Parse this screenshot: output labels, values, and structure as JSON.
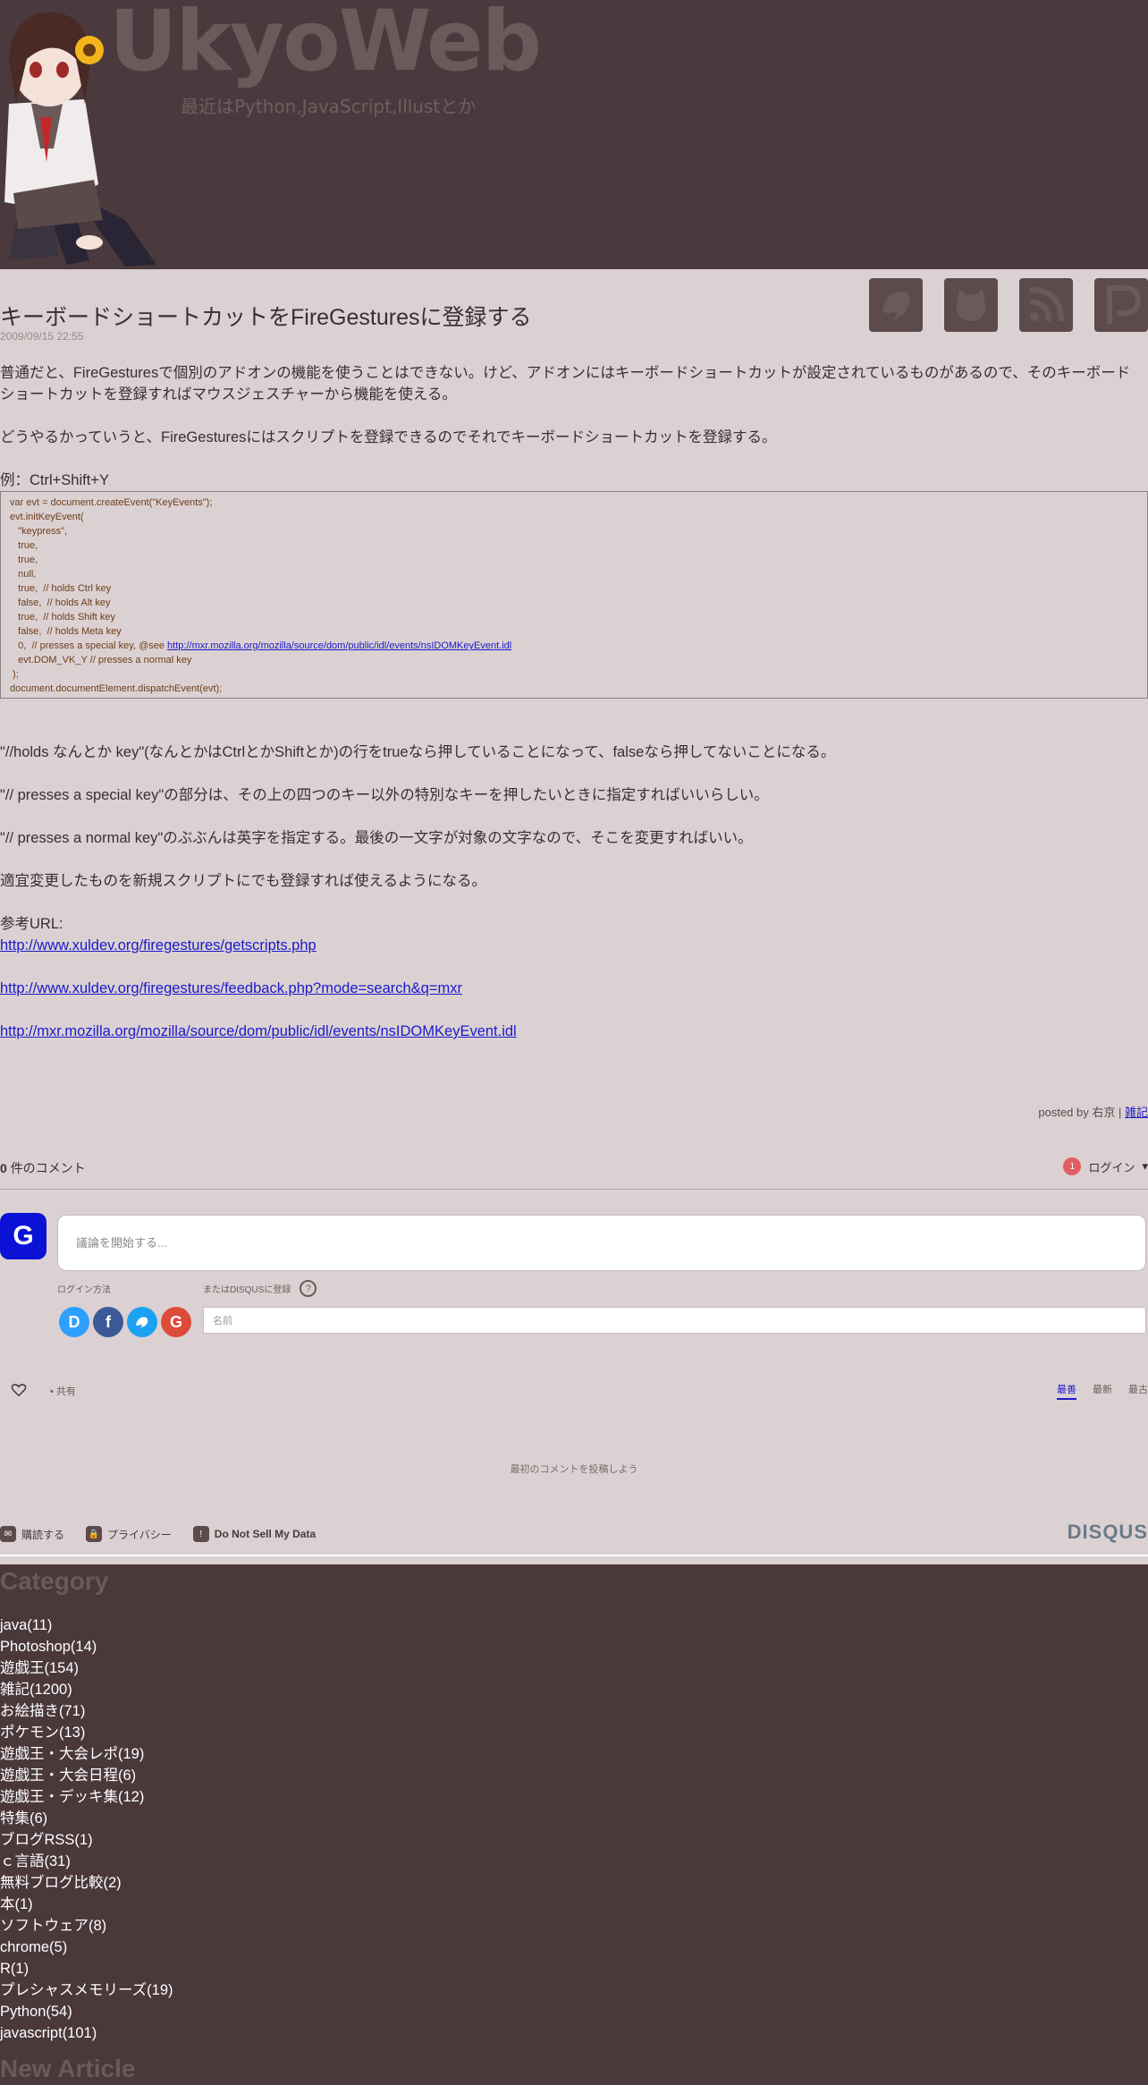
{
  "header": {
    "title": "UkyoWeb",
    "subtitle": "最近はPython,JavaScript,Illustとか"
  },
  "social_icons": [
    "twitter-bird-icon",
    "github-cat-icon",
    "rss-icon",
    "pixiv-icon"
  ],
  "post": {
    "title": "キーボードショートカットをFireGesturesに登録する",
    "date": "2009/09/15 22:55",
    "p1": "普通だと、FireGesturesで個別のアドオンの機能を使うことはできない。けど、アドオンにはキーボードショートカットが設定されているものがあるので、そのキーボードショートカットを登録すればマウスジェスチャーから機能を使える。",
    "p2": "どうやるかっていうと、FireGesturesにはスクリプトを登録できるのでそれでキーボードショートカットを登録する。",
    "example_label": "例：Ctrl+Shift+Y",
    "code": [
      "var evt = document.createEvent(\"KeyEvents\");",
      "evt.initKeyEvent(",
      "   \"keypress\",",
      "   true,",
      "   true,",
      "   null,",
      "   true,  // holds Ctrl key",
      "   false,  // holds Alt key",
      "   true,  // holds Shift key",
      "   false,  // holds Meta key",
      "   0,  // presses a special key, @see ",
      "   evt.DOM_VK_Y // presses a normal key",
      " );",
      "document.documentElement.dispatchEvent(evt);"
    ],
    "code_link": "http://mxr.mozilla.org/mozilla/source/dom/public/idl/events/nsIDOMKeyEvent.idl",
    "p3": "\"//holds なんとか key\"(なんとかはCtrlとかShiftとか)の行をtrueなら押していることになって、falseなら押してないことになる。",
    "p4": "\"// presses a special key\"の部分は、その上の四つのキー以外の特別なキーを押したいときに指定すればいいらしい。",
    "p5": "\"// presses a normal key\"のぶぶんは英字を指定する。最後の一文字が対象の文字なので、そこを変更すればいい。",
    "p6": "適宜変更したものを新規スクリプトにでも登録すれば使えるようになる。",
    "ref_label": "参考URL:",
    "ref1": "http://www.xuldev.org/firegestures/getscripts.php",
    "ref2": "http://www.xuldev.org/firegestures/feedback.php?mode=search&q=mxr",
    "ref3": "http://mxr.mozilla.org/mozilla/source/dom/public/idl/events/nsIDOMKeyEvent.idl",
    "posted_by": "posted by 右京 |",
    "posted_category": "雑記"
  },
  "disqus": {
    "comment_count": "0",
    "comment_label": "件のコメント",
    "notif_count": "1",
    "login_label": "ログイン",
    "guest_initial": "G",
    "comment_placeholder": "議論を開始する...",
    "login_with": "ログイン方法",
    "disqus_signup": "またはDISQUSに登録",
    "help": "?",
    "name_placeholder": "名前",
    "share_label": "共有",
    "sort": [
      "最善",
      "最新",
      "最古"
    ],
    "empty": "最初のコメントを投稿しよう",
    "footer": [
      {
        "icon": "✉",
        "label": "購読する",
        "name": "subscribe"
      },
      {
        "icon": "🔒",
        "label": "プライバシー",
        "name": "privacy"
      },
      {
        "icon": "!",
        "label": "Do Not Sell My Data",
        "name": "do-not-sell"
      }
    ],
    "logo": "DISQUS"
  },
  "sidebar": {
    "category_heading": "Category",
    "categories": [
      "java(11)",
      "Photoshop(14)",
      "遊戯王(154)",
      "雑記(1200)",
      "お絵描き(71)",
      "ポケモン(13)",
      "遊戯王・大会レポ(19)",
      "遊戯王・大会日程(6)",
      "遊戯王・デッキ集(12)",
      "特集(6)",
      "ブログRSS(1)",
      "ｃ言語(31)",
      "無料ブログ比較(2)",
      "本(1)",
      "ソフトウェア(8)",
      "chrome(5)",
      "R(1)",
      "プレシャスメモリーズ(19)",
      "Python(54)",
      "javascript(101)"
    ],
    "new_article_heading": "New Article"
  }
}
